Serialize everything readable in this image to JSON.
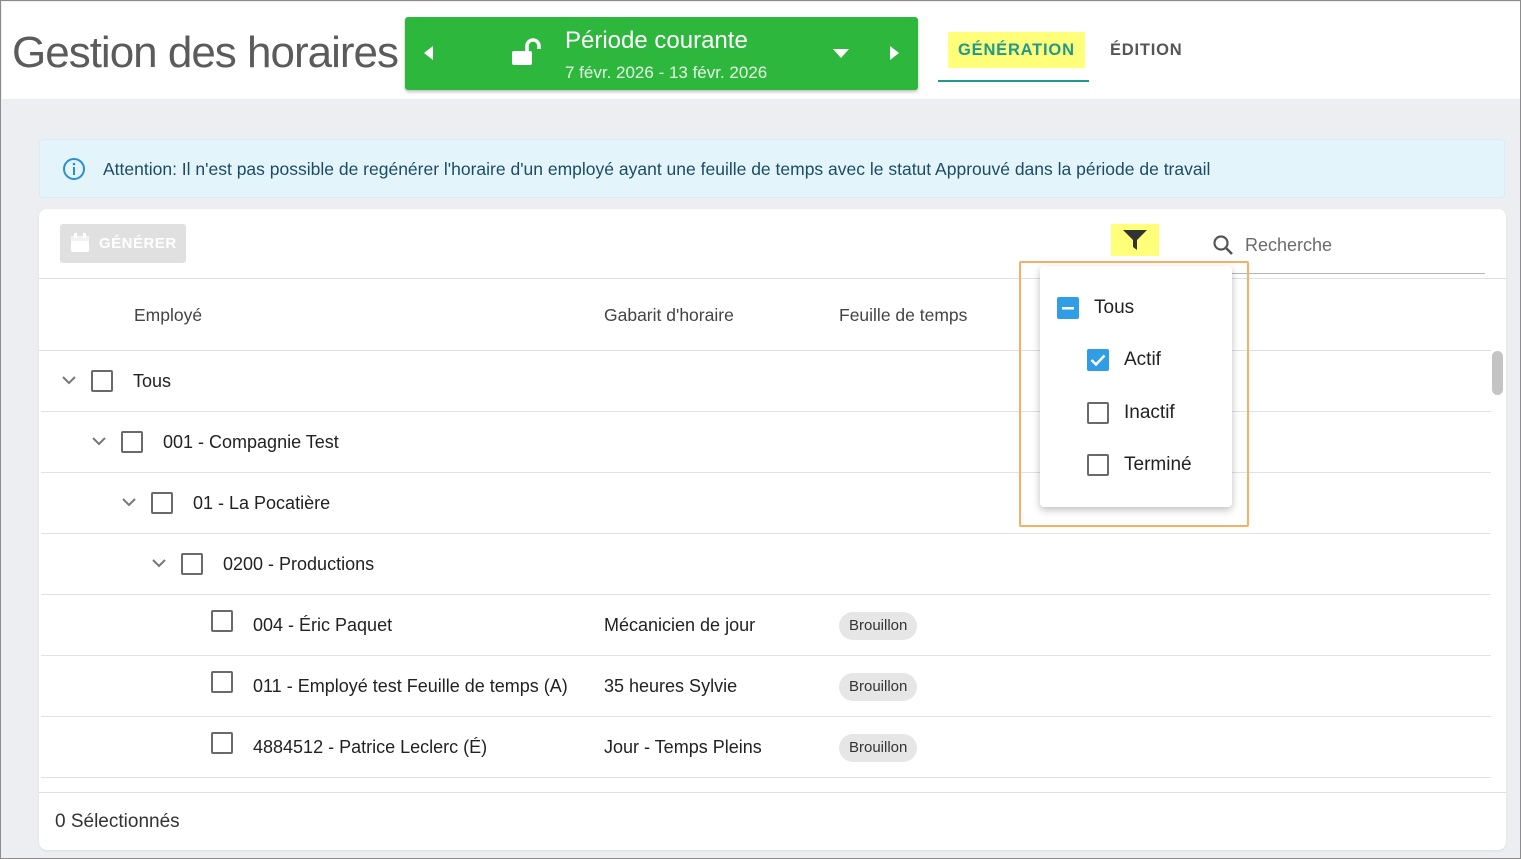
{
  "header": {
    "title": "Gestion des horaires",
    "period": {
      "title": "Période courante",
      "dates": "7 févr. 2026 - 13 févr. 2026"
    },
    "tabs": [
      {
        "label": "GÉNÉRATION",
        "active": true
      },
      {
        "label": "ÉDITION",
        "active": false
      }
    ]
  },
  "alert": {
    "text": "Attention: Il n'est pas possible de regénérer l'horaire d'un employé ayant une feuille de temps avec le statut Approuvé dans la période de travail"
  },
  "toolbar": {
    "generate_label": "GÉNÉRER",
    "search_placeholder": "Recherche"
  },
  "table": {
    "columns": [
      "Employé",
      "Gabarit d'horaire",
      "Feuille de temps"
    ],
    "rows": [
      {
        "label": "Tous",
        "level": 0,
        "expandable": true
      },
      {
        "label": "001 - Compagnie Test",
        "level": 1,
        "expandable": true
      },
      {
        "label": "01 - La Pocatière",
        "level": 2,
        "expandable": true
      },
      {
        "label": "0200 - Productions",
        "level": 3,
        "expandable": true
      },
      {
        "label": "004 - Éric Paquet",
        "schedule": "Mécanicien de jour",
        "status": "Brouillon",
        "level": 4
      },
      {
        "label": "011 - Employé test Feuille de temps (A)",
        "schedule": "35 heures Sylvie",
        "status": "Brouillon",
        "level": 4
      },
      {
        "label": "4884512 - Patrice Leclerc (É)",
        "schedule": "Jour - Temps Pleins",
        "status": "Brouillon",
        "level": 4
      }
    ]
  },
  "footer": {
    "selected": "0 Sélectionnés"
  },
  "filter_popup": {
    "all": {
      "label": "Tous",
      "state": "indeterminate"
    },
    "options": [
      {
        "label": "Actif",
        "checked": true
      },
      {
        "label": "Inactif",
        "checked": false
      },
      {
        "label": "Terminé",
        "checked": false
      }
    ]
  },
  "colors": {
    "period_bg": "#2db83d",
    "accent_teal": "#1f9a8a",
    "highlight_yellow": "#ffff7a",
    "checkbox_blue": "#2f9ee6",
    "popup_outline": "#f4b066",
    "alert_bg": "#e4f4fb"
  }
}
